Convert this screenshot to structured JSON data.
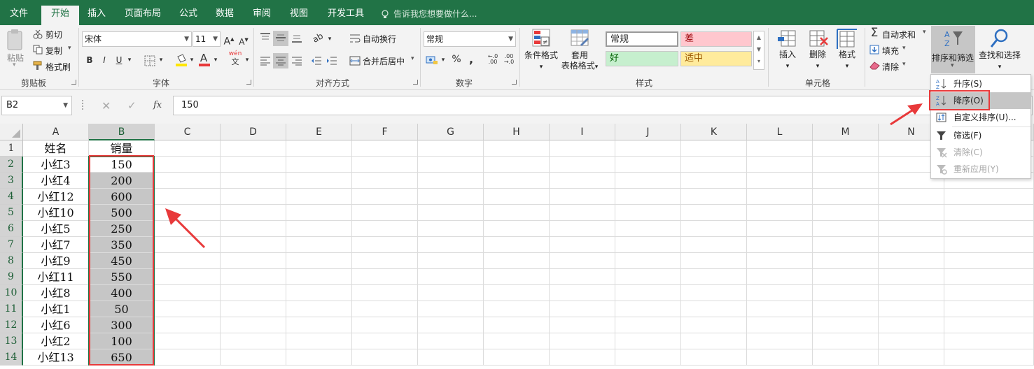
{
  "colors": {
    "brand": "#217346",
    "highlight_red": "#e8393a",
    "bad_fill": "#ffc7ce",
    "good_fill": "#c6efce",
    "neutral_fill": "#ffeb9c"
  },
  "tabs": [
    "文件",
    "开始",
    "插入",
    "页面布局",
    "公式",
    "数据",
    "审阅",
    "视图",
    "开发工具"
  ],
  "tell_me": "告诉我您想要做什么...",
  "clipboard": {
    "paste": "粘贴",
    "cut": "剪切",
    "copy": "复制",
    "format_painter": "格式刷",
    "group": "剪贴板"
  },
  "font": {
    "name": "宋体",
    "size": "11",
    "group": "字体"
  },
  "alignment": {
    "wrap": "自动换行",
    "merge": "合并后居中",
    "group": "对齐方式"
  },
  "number": {
    "format": "常规",
    "group": "数字"
  },
  "styles": {
    "conditional": "条件格式",
    "table1": "套用",
    "table2": "表格格式",
    "normal": "常规",
    "bad": "差",
    "good": "好",
    "neutral": "适中",
    "group": "样式"
  },
  "cells": {
    "insert": "插入",
    "delete": "删除",
    "format": "格式",
    "group": "单元格"
  },
  "editing": {
    "autosum": "自动求和",
    "fill": "填充",
    "clear": "清除",
    "sort_filter": "排序和筛选",
    "find_select": "查找和选择"
  },
  "sort_menu": {
    "asc": "升序(S)",
    "desc": "降序(O)",
    "custom": "自定义排序(U)...",
    "filter": "筛选(F)",
    "clear": "清除(C)",
    "reapply": "重新应用(Y)"
  },
  "formula_bar": {
    "name_box": "B2",
    "fx": "fx",
    "value": "150"
  },
  "columns": [
    "A",
    "B",
    "C",
    "D",
    "E",
    "F",
    "G",
    "H",
    "I",
    "J",
    "K",
    "L",
    "M",
    "N"
  ],
  "rows": [
    "1",
    "2",
    "3",
    "4",
    "5",
    "6",
    "7",
    "8",
    "9",
    "10",
    "11",
    "12",
    "13",
    "14"
  ],
  "data": [
    [
      "姓名",
      "销量"
    ],
    [
      "小红3",
      "150"
    ],
    [
      "小红4",
      "200"
    ],
    [
      "小红12",
      "600"
    ],
    [
      "小红10",
      "500"
    ],
    [
      "小红5",
      "250"
    ],
    [
      "小红7",
      "350"
    ],
    [
      "小红9",
      "450"
    ],
    [
      "小红11",
      "550"
    ],
    [
      "小红8",
      "400"
    ],
    [
      "小红1",
      "50"
    ],
    [
      "小红6",
      "300"
    ],
    [
      "小红2",
      "100"
    ],
    [
      "小红13",
      "650"
    ]
  ]
}
